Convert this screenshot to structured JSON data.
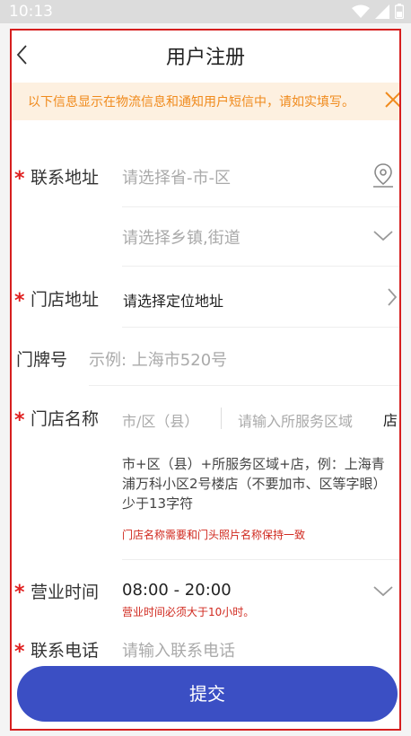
{
  "status_bar": {
    "time": "10:13"
  },
  "nav": {
    "title": "用户注册"
  },
  "notice": {
    "text": "以下信息显示在物流信息和通知用户短信中，请如实填写。"
  },
  "form": {
    "required_mark": "*",
    "contact_address": {
      "label": "联系地址",
      "region_placeholder": "请选择省-市-区",
      "street_placeholder": "请选择乡镇,街道"
    },
    "store_address": {
      "label": "门店地址",
      "value": "请选择定位地址"
    },
    "door_number": {
      "label": "门牌号",
      "placeholder": "示例: 上海市520号"
    },
    "store_name": {
      "label": "门店名称",
      "city_placeholder": "市/区（县）",
      "area_placeholder": "请输入所服务区域",
      "suffix": "店",
      "helper": "市+区（县）+所服务区域+店，例：上海青浦万科小区2号楼店（不要加市、区等字眼）少于13字符",
      "warning": "门店名称需要和门头照片名称保持一致"
    },
    "business_hours": {
      "label": "营业时间",
      "value": "08:00 - 20:00",
      "warning": "营业时间必须大于10小时。"
    },
    "phone": {
      "label": "联系电话",
      "placeholder": "请输入联系电话"
    }
  },
  "submit": {
    "label": "提交"
  },
  "colors": {
    "accent": "#3b4fc4",
    "required": "#e02020",
    "notice_text": "#f08a1c",
    "notice_bg": "#fdf0e0",
    "frame_border": "#d61f1f"
  }
}
